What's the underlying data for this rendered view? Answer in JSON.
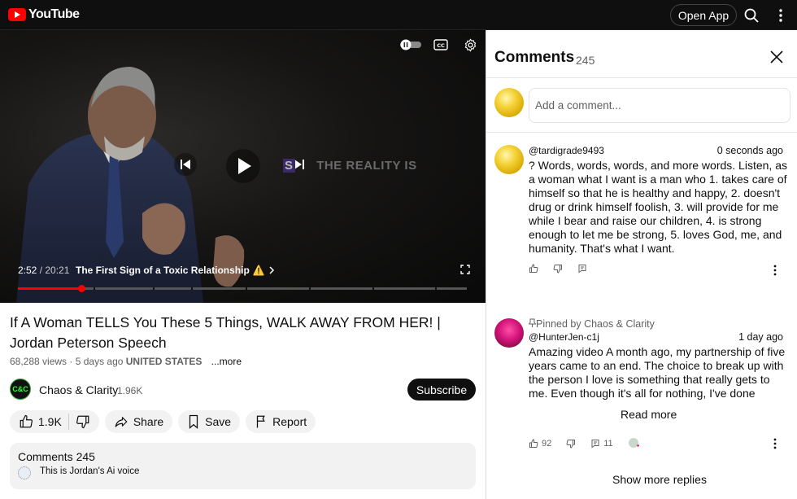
{
  "topbar": {
    "logo_text": "YouTube",
    "open_app_label": "Open App",
    "icons": {
      "search": "search-icon",
      "more": "more-vert-icon"
    }
  },
  "player": {
    "overlay_text_highlight": "S",
    "overlay_text": "THE REALITY IS",
    "current_time": "2:52",
    "duration": "/ 20:21",
    "chapter_title": "The First Sign of a Toxic Relationship",
    "chapter_emoji": "⚠️",
    "progress_fraction": 0.141,
    "icons": {
      "autoplay": "autoplay-toggle-icon",
      "captions": "cc-icon",
      "settings": "gear-icon",
      "prev": "skip-previous-icon",
      "play": "play-icon",
      "next": "skip-next-icon",
      "fullscreen": "fullscreen-icon"
    }
  },
  "video": {
    "title": "If A Woman TELLS You These 5 Things, WALK AWAY FROM HER! | Jordan Peterson Speech",
    "views": "68,288 views · 5 days ago",
    "location": "UNITED STATES",
    "more_label": "...more"
  },
  "channel": {
    "avatar_text": "C&C",
    "name": "Chaos & Clarity",
    "subscribers": "1.96K",
    "subscribe_label": "Subscribe"
  },
  "actions": {
    "likes": "1.9K",
    "share_label": "Share",
    "save_label": "Save",
    "report_label": "Report"
  },
  "comments_card": {
    "title": "Comments 245",
    "preview_text": "This is Jordan's Ai voice"
  },
  "panel": {
    "title": "Comments",
    "count": "245",
    "add_placeholder": "Add a comment...",
    "comments": [
      {
        "handle": "@tardigrade9493",
        "time": "0 seconds ago",
        "text": "? Words, words, words, and more words. Listen, as a woman what I want is a man who 1. takes care of himself so that he is healthy and happy, 2. doesn't drug or drink himself foolish, 3. will provide for me while I bear and raise our children, 4. is strong enough to let me be strong, 5. loves God, me, and humanity. That's what I want."
      },
      {
        "pinned": "Pinned by Chaos & Clarity",
        "handle": "@HunterJen-c1j",
        "time": "1 day ago",
        "text": "Amazing video A month ago, my partnership of five years came to an end. The choice to break up with the person I love is something that really gets to me. Even though it's all for nothing, I've done everything I",
        "read_more": "Read more",
        "likes": "92",
        "replies": "11",
        "show_replies": "Show more replies"
      }
    ]
  }
}
